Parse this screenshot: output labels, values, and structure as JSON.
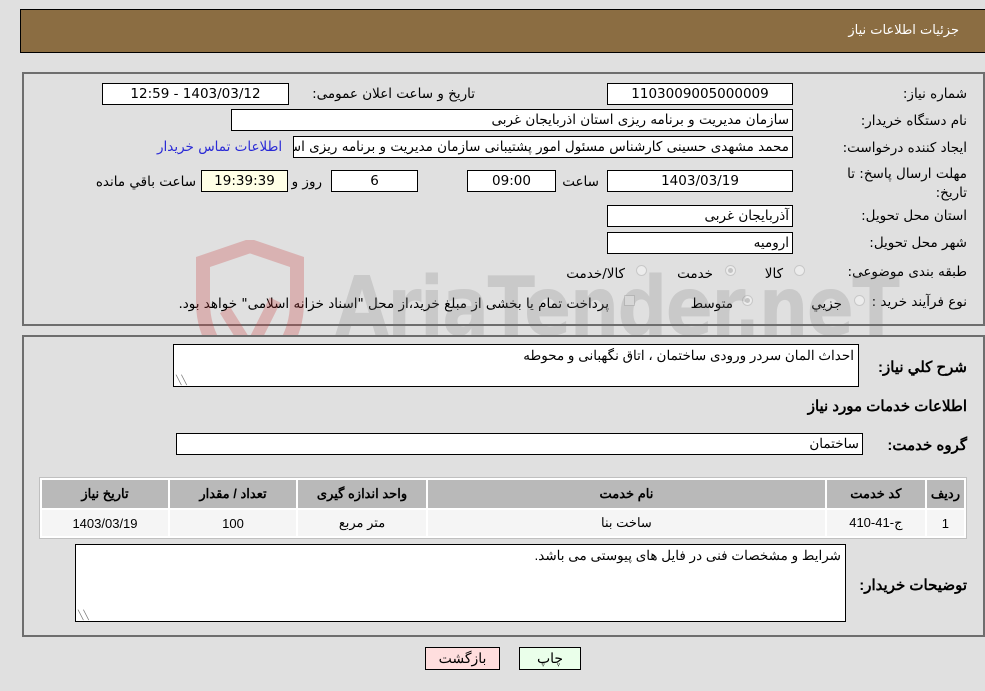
{
  "header": {
    "title": "جزئیات اطلاعات نیاز"
  },
  "form": {
    "need_number": {
      "label": "شماره نیاز:",
      "value": "1103009005000009"
    },
    "announce_datetime": {
      "label": "تاریخ و ساعت اعلان عمومی:",
      "value": "1403/03/12 - 12:59"
    },
    "buyer_org": {
      "label": "نام دستگاه خریدار:",
      "value": "سازمان مدیریت و برنامه ریزی استان اذربایجان غربی"
    },
    "requester": {
      "label": "ایجاد کننده درخواست:",
      "value": "محمد مشهدی حسینی کارشناس مسئول امور پشتیبانی سازمان مدیریت و برنامه ریزی استان اذربایجان غربی",
      "contact_link": "اطلاعات تماس خریدار"
    },
    "deadline": {
      "label": "مهلت ارسال پاسخ: تا تاریخ:",
      "date": "1403/03/19",
      "time_label": "ساعت",
      "time": "09:00",
      "days": "6",
      "days_label": "روز و",
      "remaining": "19:39:39",
      "remaining_label": "ساعت باقي مانده"
    },
    "delivery_province": {
      "label": "استان محل تحویل:",
      "value": "آذربایجان غربی"
    },
    "delivery_city": {
      "label": "شهر محل تحویل:",
      "value": "ارومیه"
    },
    "category": {
      "label": "طبقه بندی موضوعی:",
      "options": [
        "کالا",
        "خدمت",
        "کالا/خدمت"
      ],
      "selected": "خدمت"
    },
    "purchase_type": {
      "label": "نوع فرآیند خرید :",
      "options": [
        "جزيي",
        "متوسط"
      ],
      "selected": "متوسط",
      "treasury_note": "پرداخت تمام یا بخشی از مبلغ خرید،از محل \"اسناد خزانه اسلامی\" خواهد بود."
    }
  },
  "details": {
    "description_label": "شرح كلي نياز:",
    "description": "احداث المان سردر ورودی ساختمان ، اتاق نگهبانی و محوطه",
    "services_heading": "اطلاعات خدمات مورد نیاز",
    "service_group_label": "گروه خدمت:",
    "service_group": "ساختمان",
    "table": {
      "headers": [
        "ردیف",
        "کد خدمت",
        "نام خدمت",
        "واحد اندازه گیری",
        "تعداد / مقدار",
        "تاریخ نیاز"
      ],
      "rows": [
        [
          "1",
          "ج-41-410",
          "ساخت بنا",
          "متر مربع",
          "100",
          "1403/03/19"
        ]
      ]
    },
    "buyer_notes_label": "توضیحات خریدار:",
    "buyer_notes": "شرایط و مشخصات فنی در فایل های پیوستی می باشد."
  },
  "buttons": {
    "print": "چاپ",
    "back": "بازگشت"
  },
  "watermark": {
    "text": "AriaTender.neT"
  },
  "colors": {
    "header_bg": "#8b6d42",
    "link": "#2a2ad6",
    "back_btn": "#ffdede",
    "print_btn": "#eaffea",
    "remaining_bg": "#ffffe6"
  }
}
